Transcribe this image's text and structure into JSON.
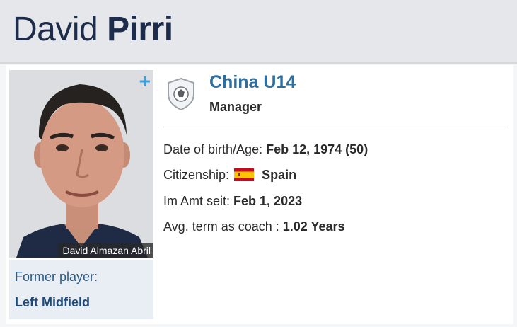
{
  "header": {
    "first_name": "David",
    "last_name": "Pirri"
  },
  "photo": {
    "plus": "+",
    "caption": "David Almazan Abril"
  },
  "former": {
    "label": "Former player:",
    "position": "Left Midfield"
  },
  "club": {
    "name": "China U14",
    "role": "Manager",
    "icon": "club-crest-shield-icon"
  },
  "details": {
    "dob_label": "Date of birth/Age:",
    "dob_value": "Feb 12, 1974 (50)",
    "citizenship_label": "Citizenship:",
    "citizenship_flag": "spain-flag-icon",
    "citizenship_value": "Spain",
    "in_office_label": "Im Amt seit:",
    "in_office_value": "Feb 1, 2023",
    "avg_term_label": "Avg. term as coach :",
    "avg_term_value": "1.02 Years"
  },
  "colors": {
    "accent_blue": "#2f6f9f",
    "header_bg": "#e6e7ea",
    "plus_blue": "#3aa0dd"
  }
}
